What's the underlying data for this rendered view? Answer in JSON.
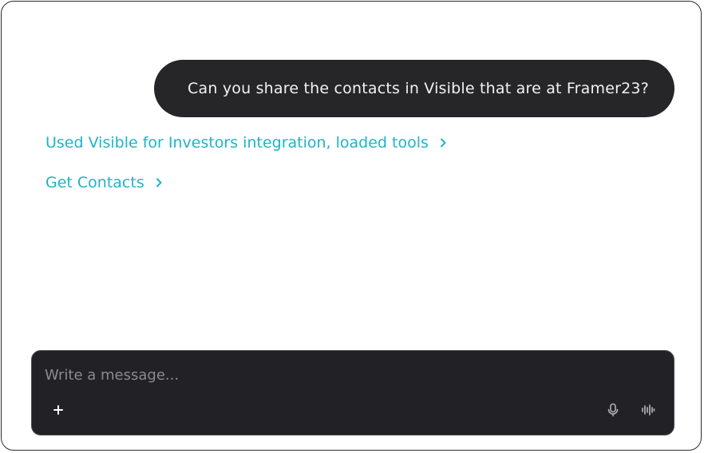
{
  "conversation": {
    "user_message": "Can you share the contacts in Visible that are at Framer23?",
    "tool_steps": [
      {
        "label": "Used Visible for Investors integration, loaded tools"
      },
      {
        "label": "Get Contacts"
      }
    ]
  },
  "composer": {
    "placeholder": "Write a message...",
    "value": ""
  },
  "icons": {
    "attach": "plus-icon",
    "microphone": "microphone-icon",
    "voice": "waveform-icon",
    "chevron": "chevron-right-icon"
  },
  "colors": {
    "accent": "#1fb3c7",
    "bubble": "#262628",
    "composer": "#222226"
  }
}
